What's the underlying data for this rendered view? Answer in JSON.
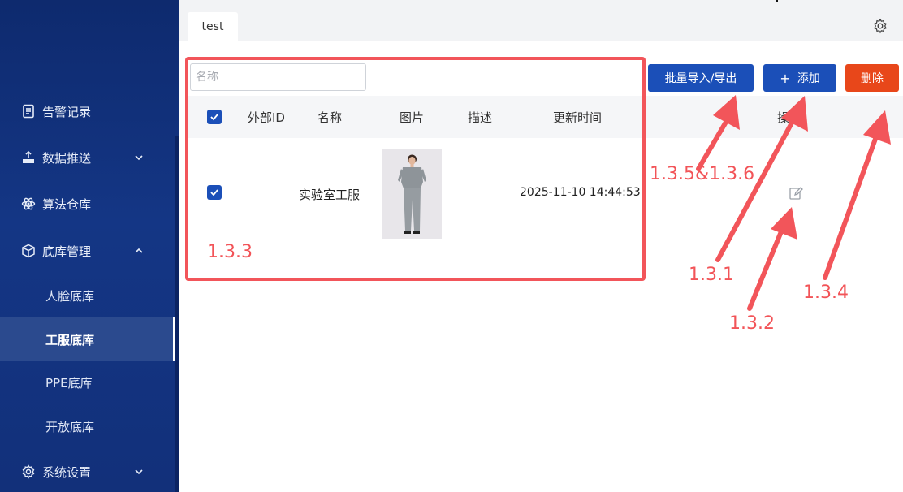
{
  "sidebar": {
    "items": [
      {
        "label": "告警记录",
        "icon": "document-icon"
      },
      {
        "label": "数据推送",
        "icon": "upload-icon",
        "expanded": false
      },
      {
        "label": "算法仓库",
        "icon": "atom-icon"
      },
      {
        "label": "底库管理",
        "icon": "box-icon",
        "expanded": true
      },
      {
        "label": "系统设置",
        "icon": "gear-icon",
        "expanded": false
      }
    ],
    "sub_items": [
      {
        "label": "人脸底库",
        "active": false
      },
      {
        "label": "工服底库",
        "active": true
      },
      {
        "label": "PPE底库",
        "active": false
      },
      {
        "label": "开放底库",
        "active": false
      }
    ]
  },
  "tabs": [
    {
      "label": "test"
    }
  ],
  "toolbar": {
    "search_placeholder": "名称",
    "import_export_label": "批量导入/导出",
    "add_label": "添加",
    "add_icon": "+",
    "delete_label": "删除"
  },
  "table": {
    "columns": [
      "外部ID",
      "名称",
      "图片",
      "描述",
      "更新时间",
      "操作"
    ],
    "rows": [
      {
        "checked": true,
        "external_id": "",
        "name": "实验室工服",
        "image": "workwear-photo",
        "description": "",
        "updated": "2025-11-10 14:44:53",
        "action_icon": "edit-icon"
      }
    ],
    "header_checked": true
  },
  "annotations": {
    "labels": [
      "1.3.3",
      "1.3.5&1.3.6",
      "1.3.1",
      "1.3.2",
      "1.3.4"
    ]
  },
  "colors": {
    "sidebar_bg": "#143685",
    "primary": "#1b4fb8",
    "danger": "#e8471a",
    "annotation": "#f25458"
  }
}
